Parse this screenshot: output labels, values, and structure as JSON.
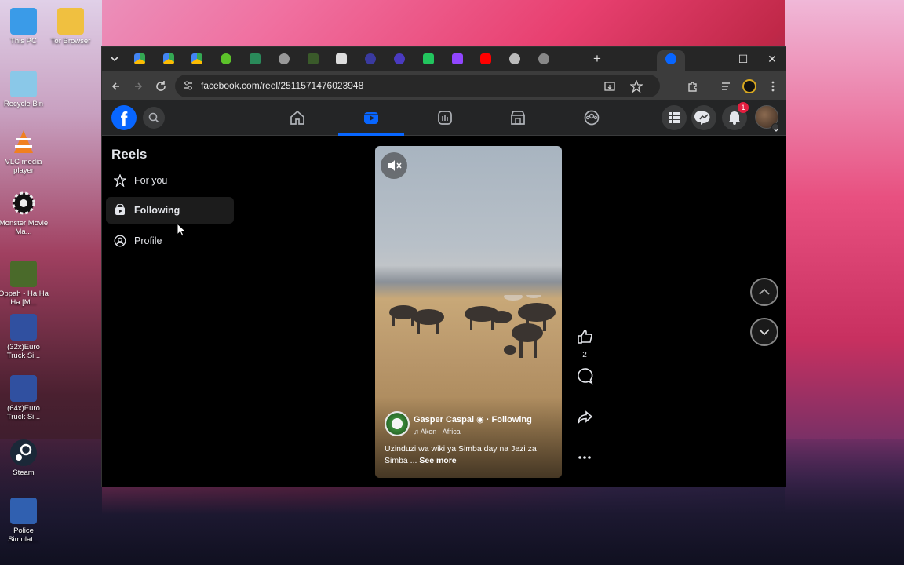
{
  "desktop": {
    "icons": [
      {
        "label": "This PC",
        "color": "#3a9be8"
      },
      {
        "label": "Tor Browser",
        "color": "#f0c040"
      },
      {
        "label": "Recycle Bin",
        "color": "#8ac8e8"
      },
      {
        "label": "VLC media player",
        "color": "#f08020"
      },
      {
        "label": "Monster Movie Ma...",
        "color": "#222222"
      },
      {
        "label": "Oppah - Ha Ha Ha [M...",
        "color": "#4a6a2a"
      },
      {
        "label": "(32x)Euro Truck Si...",
        "color": "#3050a0"
      },
      {
        "label": "(64x)Euro Truck Si...",
        "color": "#3050a0"
      },
      {
        "label": "Steam",
        "color": "#1b2838"
      },
      {
        "label": "Police Simulat...",
        "color": "#3060b0"
      }
    ]
  },
  "browser": {
    "url": "facebook.com/reel/2511571476023948",
    "window_controls": {
      "minimize": "–",
      "maximize": "☐",
      "close": "✕"
    },
    "new_tab": "+"
  },
  "facebook": {
    "notification_count": "1",
    "sidebar": {
      "title": "Reels",
      "items": [
        {
          "label": "For you",
          "icon": "star-icon"
        },
        {
          "label": "Following",
          "icon": "following-icon"
        },
        {
          "label": "Profile",
          "icon": "profile-icon"
        }
      ]
    },
    "reel": {
      "author": "Gasper Caspal",
      "follow_state": "Following",
      "music": "Akon · Africa",
      "caption": "Uzinduzi wa wiki ya Simba day na Jezi za Simba ...",
      "see_more": "See more",
      "like_count": "2"
    }
  },
  "colors": {
    "fb_blue": "#0866ff",
    "header_bg": "#242526",
    "badge_red": "#e41e3f"
  }
}
